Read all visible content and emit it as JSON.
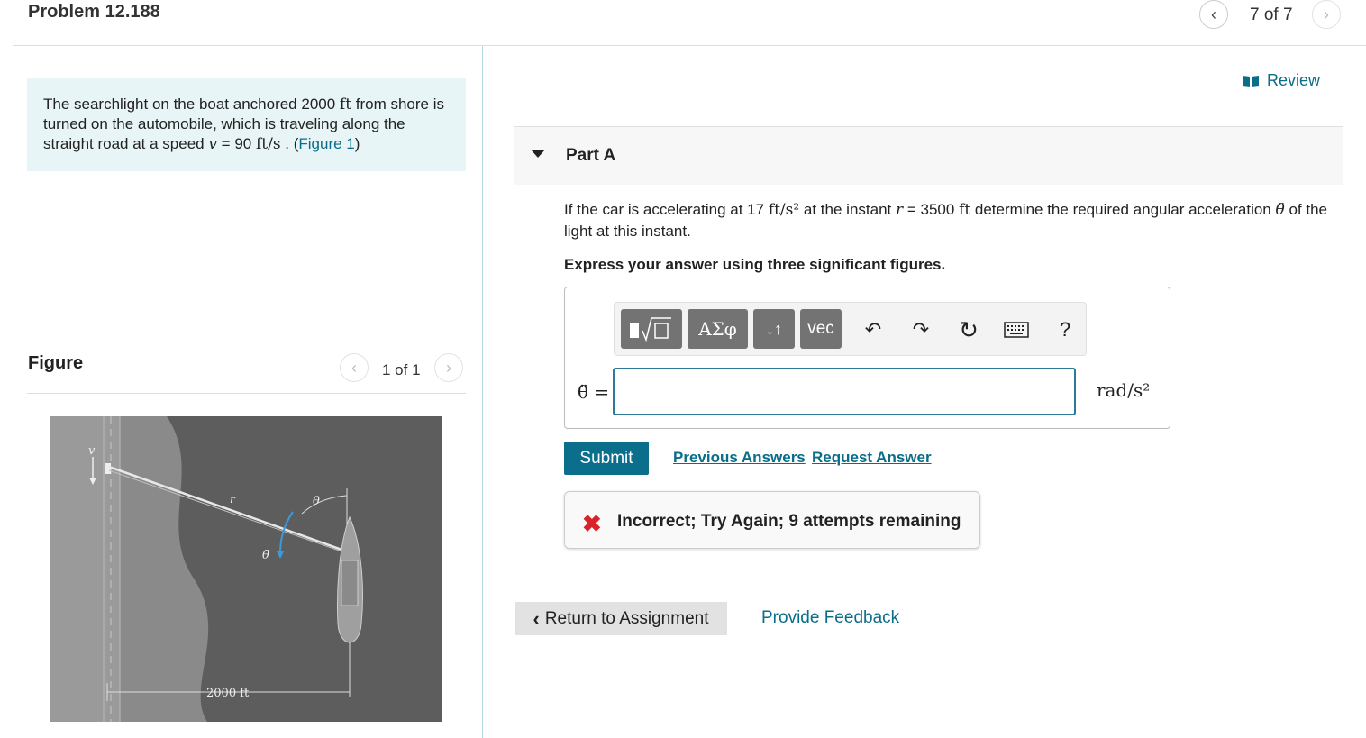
{
  "header": {
    "title": "Problem 12.188",
    "pager": "7 of 7"
  },
  "intro": {
    "t1": "The searchlight on the boat anchored 2000 ",
    "u1": "ft",
    "t2": " from shore is turned on the automobile, which is traveling along the straight road at a speed ",
    "v": "v",
    "t3": " = 90 ",
    "u2": "ft/s",
    "t4": " . (",
    "link": "Figure 1",
    "t5": ")"
  },
  "figure": {
    "title": "Figure",
    "pager": "1 of 1",
    "labels": {
      "v": "v",
      "r": "r",
      "theta": "θ",
      "theta_ddot": "θ̈",
      "distance": "2000 ft"
    }
  },
  "review": "Review",
  "partA": {
    "label": "Part A",
    "q1": "If the car is accelerating at 17 ",
    "q_unit1": "ft/s²",
    "q2": " at the instant ",
    "q_r": "r",
    "q3": " = 3500 ",
    "q_unit2": "ft",
    "q4": " determine the required angular acceleration ",
    "q_theta": "θ̈",
    "q5": " of the light at this instant.",
    "express": "Express your answer using three significant figures."
  },
  "toolbar": {
    "templates": "templates-icon",
    "greek": "ΑΣφ",
    "arrows": "↓↑",
    "vec": "vec",
    "undo": "↶",
    "redo": "↷",
    "reset": "↻",
    "keyboard": "keyboard-icon",
    "help": "?"
  },
  "answer": {
    "label": "θ̈ =",
    "value": "",
    "units": "rad/s²"
  },
  "actions": {
    "submit": "Submit",
    "previous": "Previous Answers",
    "request": "Request Answer"
  },
  "feedback": {
    "icon": "✖",
    "text": "Incorrect; Try Again; 9 attempts remaining"
  },
  "footer": {
    "return": "Return to Assignment",
    "provide": "Provide Feedback"
  },
  "colors": {
    "accent": "#0b6f8c",
    "error": "#d8232a",
    "intro_bg": "#e8f5f6"
  }
}
